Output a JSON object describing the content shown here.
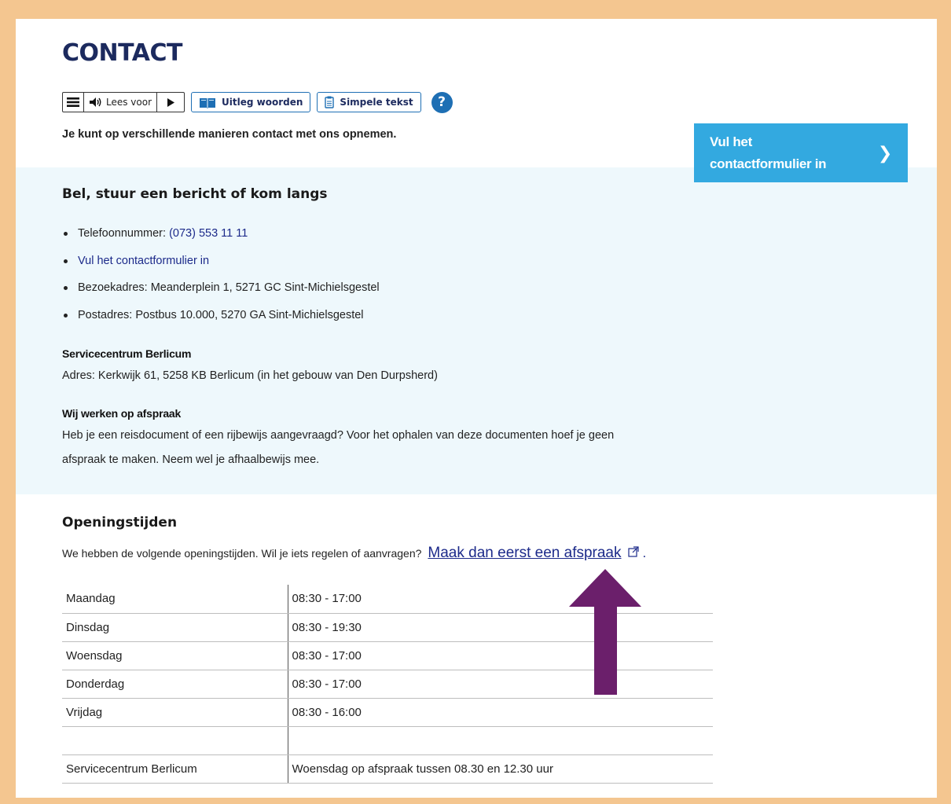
{
  "page": {
    "title": "CONTACT",
    "intro": "Je kunt op verschillende manieren contact met ons opnemen."
  },
  "toolbar": {
    "lees_voor": "Lees voor",
    "uitleg_woorden": "Uitleg woorden",
    "simpele_tekst": "Simpele tekst",
    "help": "?"
  },
  "cta": {
    "line1": "Vul het",
    "line2": "contactformulier in"
  },
  "contact": {
    "heading": "Bel, stuur een bericht of kom langs",
    "phone_label": "Telefoonnummer: ",
    "phone_value": "(073) 553 11 11",
    "form_link": "Vul het contactformulier in",
    "visit": "Bezoekadres: Meanderplein 1, 5271 GC Sint-Michielsgestel",
    "post": "Postadres: Postbus 10.000, 5270 GA Sint-Michielsgestel"
  },
  "servicecentrum": {
    "heading": "Servicecentrum Berlicum",
    "address": "Adres: Kerkwijk 61, 5258 KB Berlicum (in het gebouw van Den Durpsherd)"
  },
  "afspraak": {
    "heading": "Wij werken op afspraak",
    "line1": "Heb je een reisdocument of een rijbewijs aangevraagd? Voor het ophalen van deze documenten hoef je geen",
    "line2": "afspraak te maken. Neem wel je afhaalbewijs mee."
  },
  "opening": {
    "heading": "Openingstijden",
    "intro": "We hebben de volgende openingstijden. Wil je iets regelen of aanvragen?",
    "link": "Maak dan eerst een afspraak",
    "period": ".",
    "rows": [
      {
        "day": "Maandag",
        "time": "08:30 - 17:00"
      },
      {
        "day": "Dinsdag",
        "time": "08:30 - 19:30"
      },
      {
        "day": "Woensdag",
        "time": "08:30 - 17:00"
      },
      {
        "day": "Donderdag",
        "time": "08:30 - 17:00"
      },
      {
        "day": "Vrijdag",
        "time": "08:30 - 16:00"
      },
      {
        "day": "",
        "time": ""
      },
      {
        "day": "Servicecentrum Berlicum",
        "time": "Woensdag op afspraak tussen 08.30 en 12.30 uur"
      }
    ]
  },
  "colors": {
    "frame": "#f4c690",
    "title": "#1c2a5e",
    "cta": "#33a9e0",
    "panel": "#eef8fc",
    "link": "#1c2a8a",
    "arrow": "#6b1f6b"
  },
  "icons": [
    "menu-icon",
    "speaker-icon",
    "play-icon",
    "book-icon",
    "document-icon",
    "help-icon",
    "chevron-right-icon",
    "external-link-icon",
    "arrow-up-icon"
  ]
}
